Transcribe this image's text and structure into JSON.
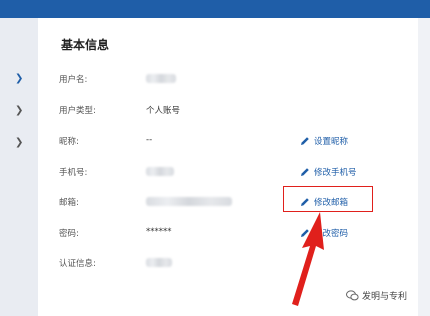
{
  "section": {
    "title": "基本信息"
  },
  "rows": [
    {
      "label": "用户名:",
      "value": "",
      "action": ""
    },
    {
      "label": "用户类型:",
      "value": "个人账号",
      "action": ""
    },
    {
      "label": "昵称:",
      "value": "--",
      "action": "设置昵称"
    },
    {
      "label": "手机号:",
      "value": "",
      "action": "修改手机号"
    },
    {
      "label": "邮箱:",
      "value": "",
      "action": "修改邮箱"
    },
    {
      "label": "密码:",
      "value": "******",
      "action": "修改密码"
    },
    {
      "label": "认证信息:",
      "value": "",
      "action": ""
    }
  ],
  "watermark": {
    "text": "发明与专利"
  },
  "colors": {
    "accent": "#1f5ea8",
    "highlight": "#e0201c",
    "topbar": "#1f5ea8"
  },
  "icons": [
    "chevron-right-icon",
    "pencil-icon",
    "wechat-icon"
  ]
}
